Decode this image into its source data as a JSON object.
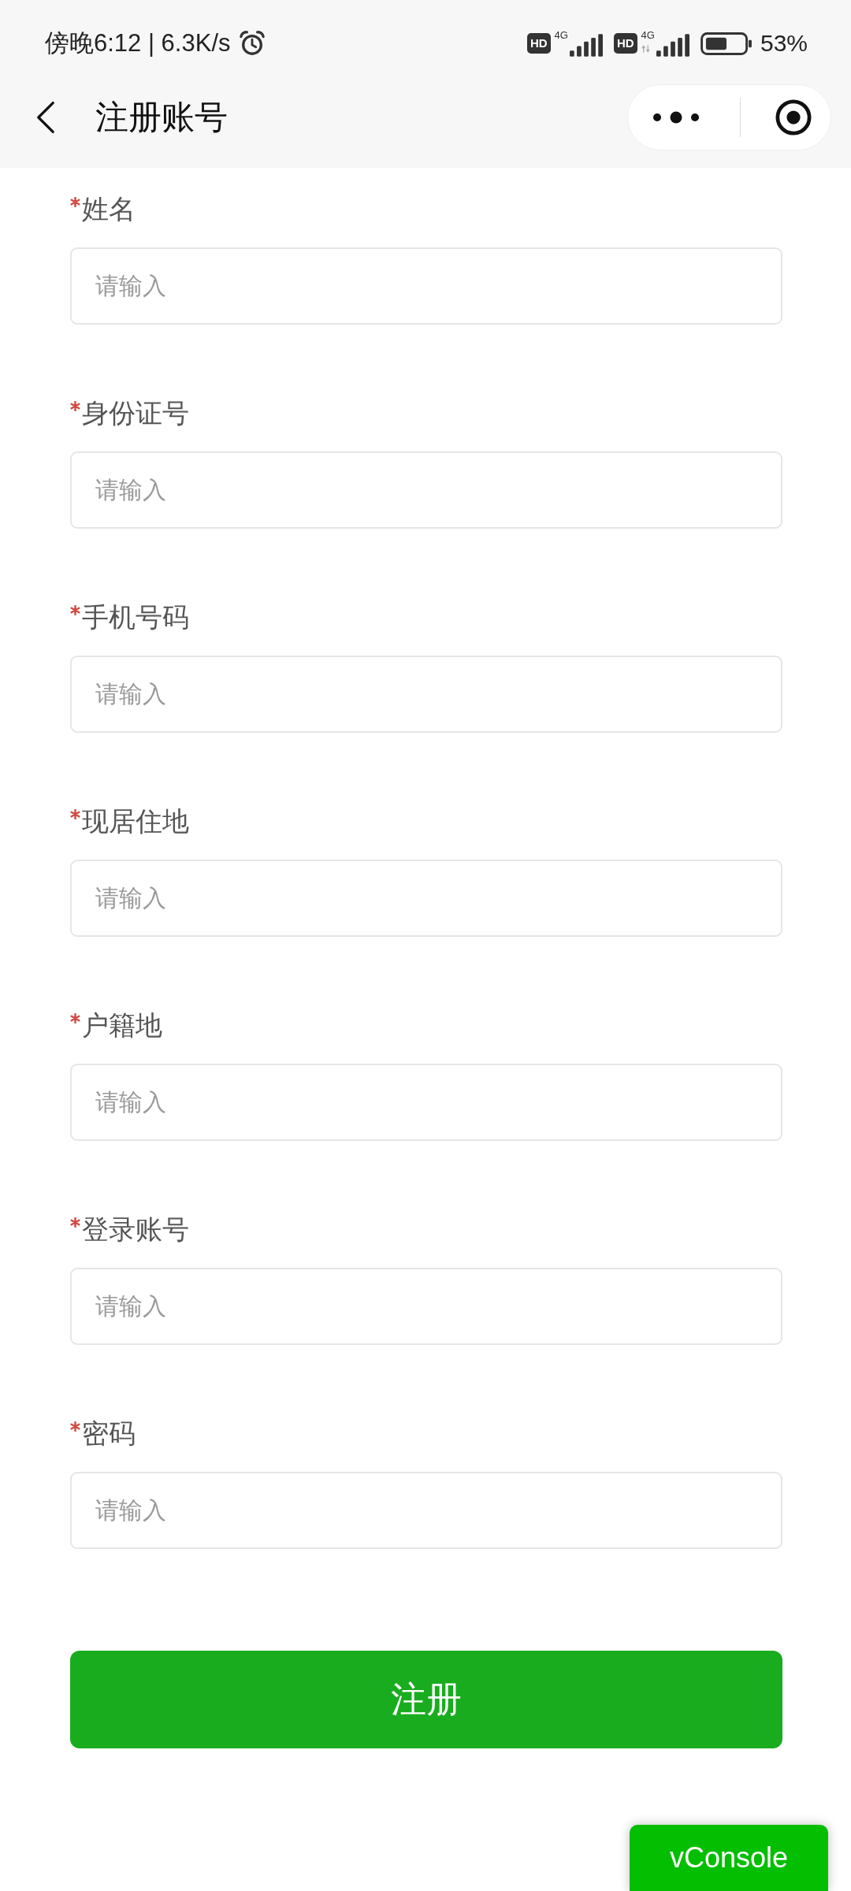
{
  "status_bar": {
    "clock_and_speed": "傍晚6:12 | 6.3K/s",
    "sims": [
      {
        "badge": "HD",
        "network": "4G",
        "data_arrows": false
      },
      {
        "badge": "HD",
        "network": "4G",
        "data_arrows": true
      }
    ],
    "battery_percent": "53%"
  },
  "nav_bar": {
    "title": "注册账号"
  },
  "fields": [
    {
      "label": "姓名",
      "required": true,
      "placeholder": "请输入"
    },
    {
      "label": "身份证号",
      "required": true,
      "placeholder": "请输入"
    },
    {
      "label": "手机号码",
      "required": true,
      "placeholder": "请输入"
    },
    {
      "label": "现居住地",
      "required": true,
      "placeholder": "请输入"
    },
    {
      "label": "户籍地",
      "required": true,
      "placeholder": "请输入"
    },
    {
      "label": "登录账号",
      "required": true,
      "placeholder": "请输入"
    },
    {
      "label": "密码",
      "required": true,
      "placeholder": "请输入"
    }
  ],
  "submit_button": {
    "label": "注册"
  },
  "debug_button": {
    "label": "vConsole"
  }
}
